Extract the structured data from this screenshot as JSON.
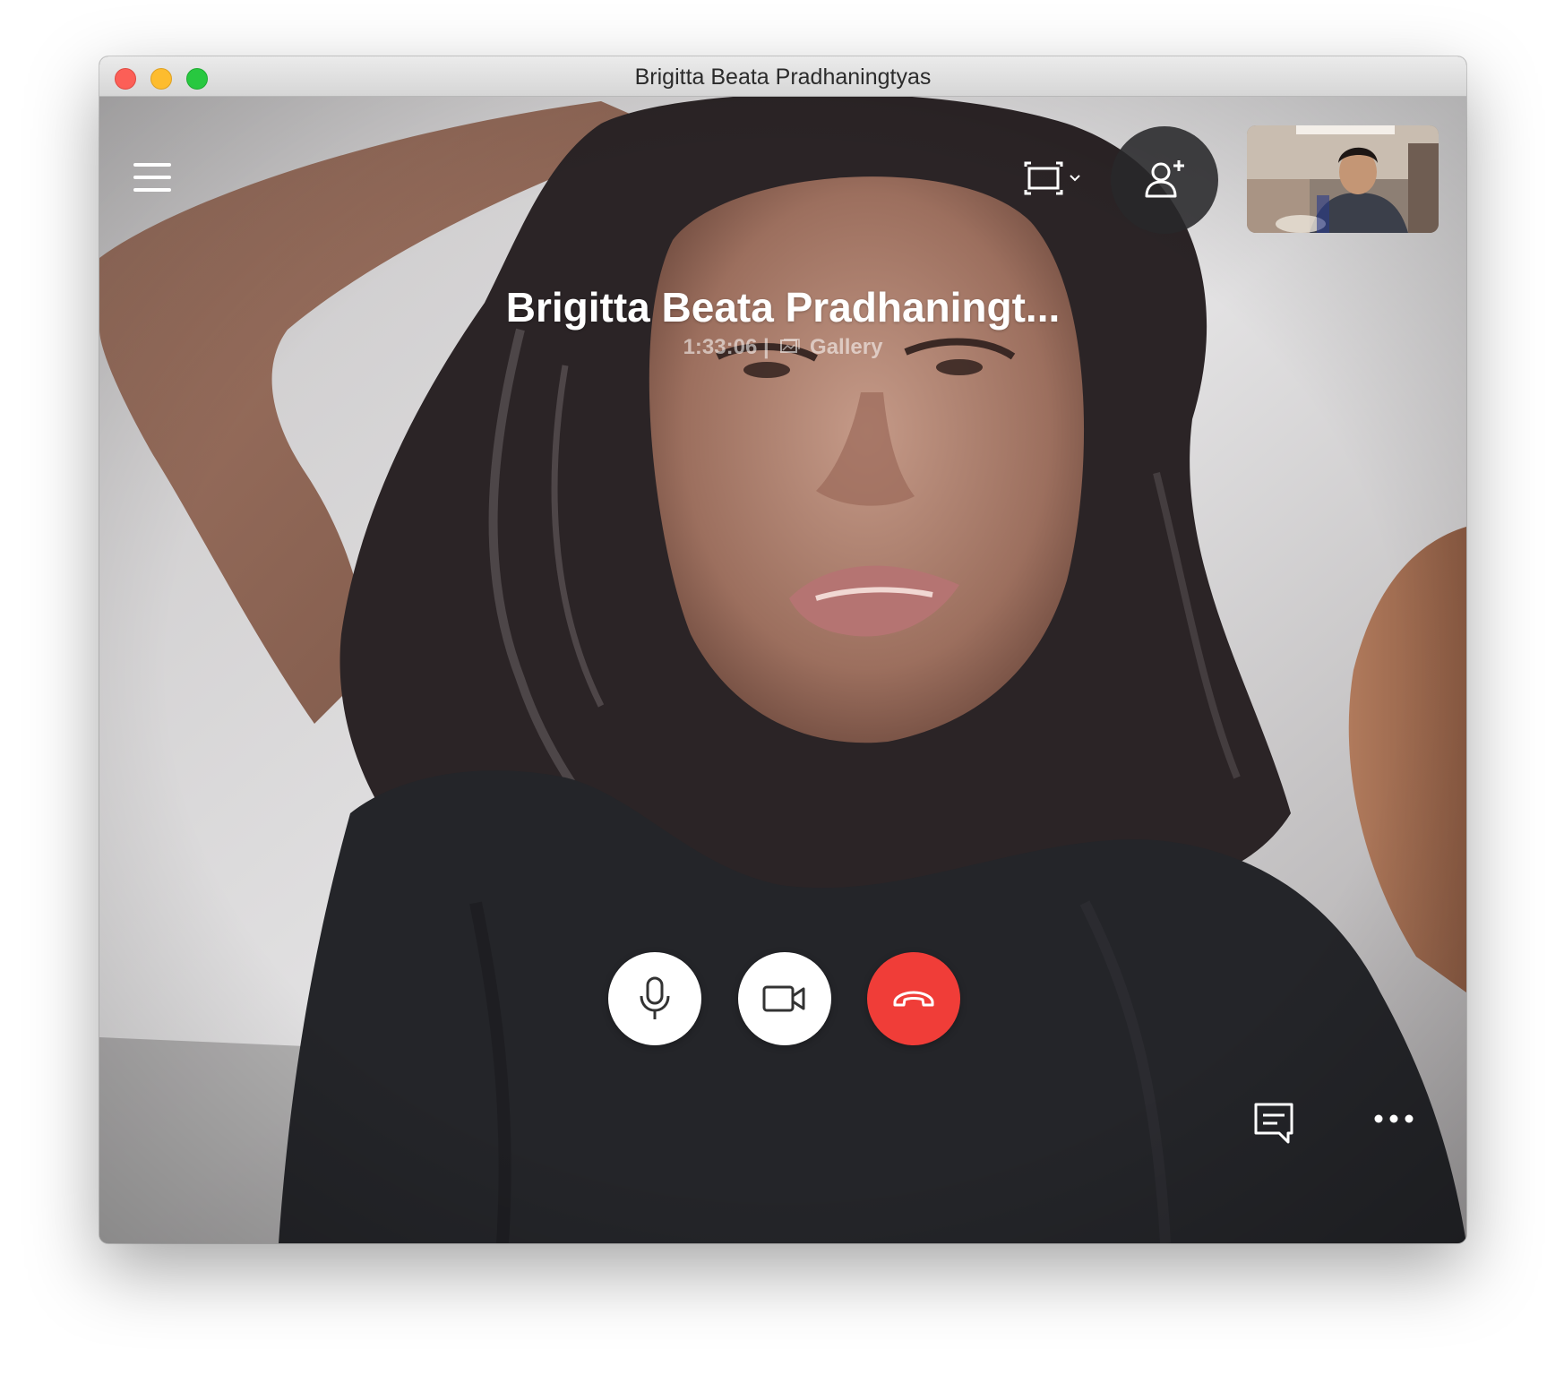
{
  "window": {
    "title": "Brigitta Beata Pradhaningtyas"
  },
  "call": {
    "caller_name": "Brigitta Beata Pradhaningt...",
    "duration": "1:33:06",
    "separator": "|",
    "view_mode": "Gallery"
  },
  "icons": {
    "menu": "hamburger-menu-icon",
    "layout": "screen-layout-icon",
    "add_participant": "add-person-icon",
    "microphone": "microphone-icon",
    "video": "video-camera-icon",
    "end_call": "hang-up-icon",
    "chat": "chat-bubble-icon",
    "more": "more-options-icon",
    "gallery": "gallery-icon"
  },
  "colors": {
    "end_call": "#f03d38",
    "control_button": "#ffffff",
    "add_button_bg": "#28282a"
  }
}
